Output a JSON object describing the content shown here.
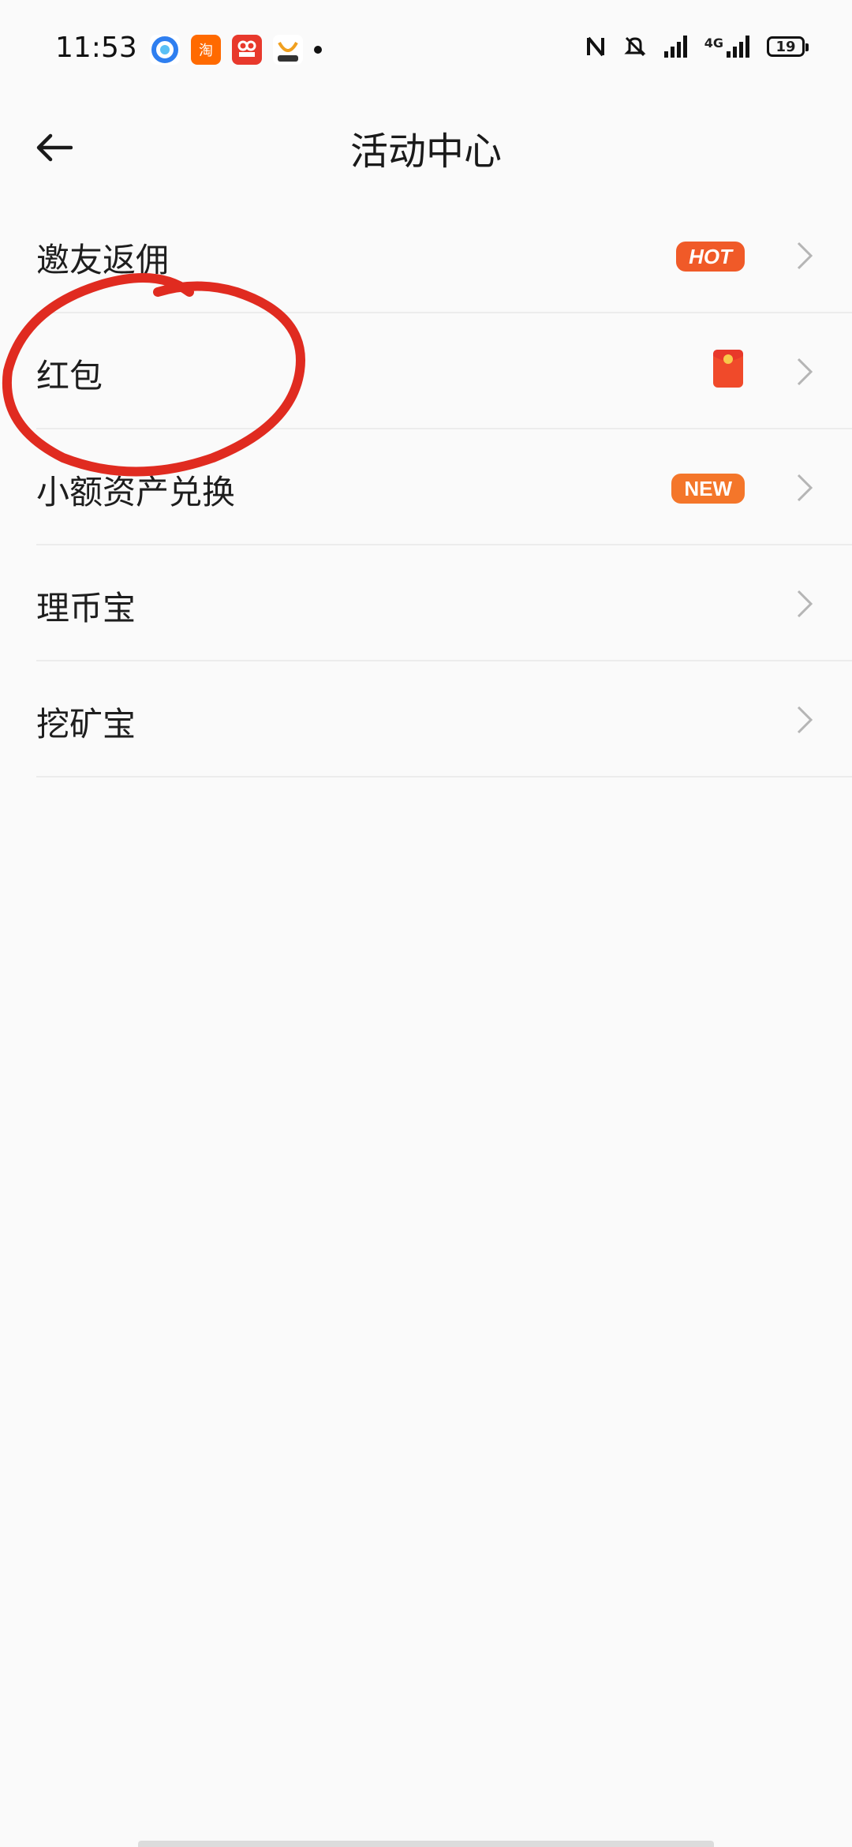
{
  "status_bar": {
    "time": "11:53",
    "battery": "19",
    "network_label": "4G",
    "icons": [
      "browser-icon",
      "taobao-icon",
      "app-icon",
      "app-icon-2",
      "nfc-icon",
      "mute-bell-icon",
      "signal-icon",
      "battery-icon"
    ]
  },
  "header": {
    "title": "活动中心",
    "back_icon": "back-arrow-icon"
  },
  "menu": {
    "items": [
      {
        "label": "邀友返佣",
        "badge": "HOT",
        "badge_color": "#f05a28"
      },
      {
        "label": "红包",
        "icon": "red-packet-icon"
      },
      {
        "label": "小额资产兑换",
        "badge": "NEW",
        "badge_color": "#f4762a"
      },
      {
        "label": "理币宝"
      },
      {
        "label": "挖矿宝"
      }
    ]
  },
  "annotation": {
    "color": "#e02b20",
    "shape": "circle around 红包"
  }
}
